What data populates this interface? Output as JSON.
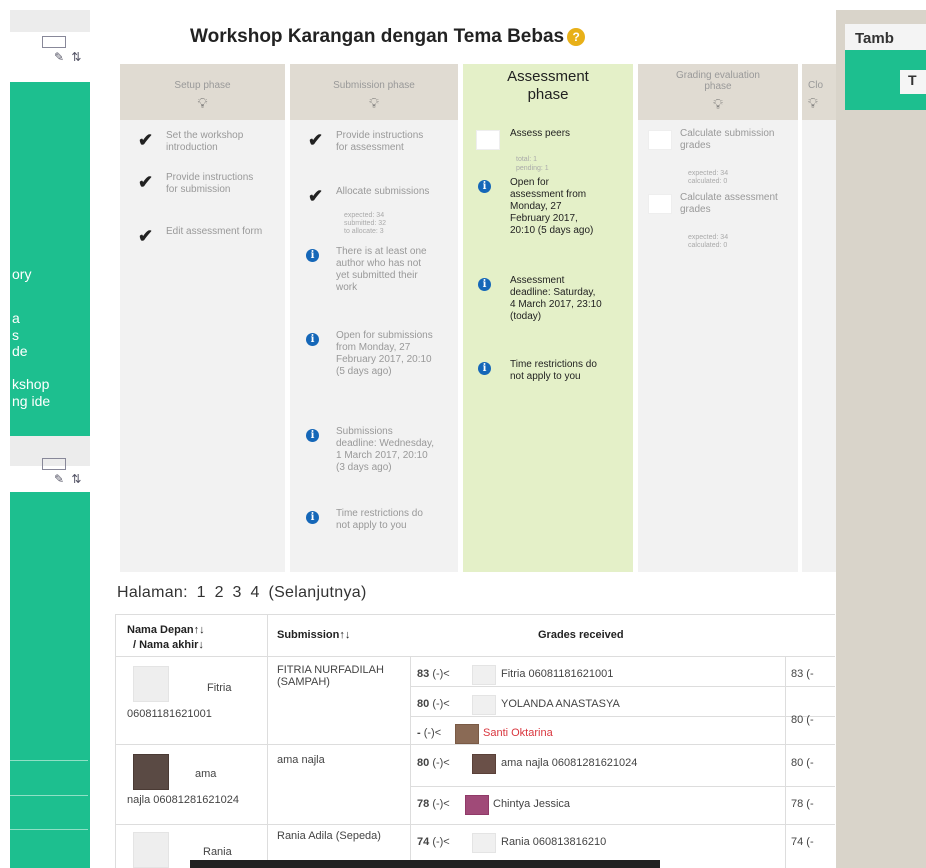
{
  "title": "Workshop Karangan dengan Tema Bebas",
  "sidebar": {
    "nav_items": [
      "ory",
      "a",
      "s",
      "de",
      "kshop",
      "ng ide"
    ]
  },
  "right_panel": {
    "heading": "Tamb",
    "button_label": "T"
  },
  "phases": [
    {
      "name": "Setup phase",
      "items": [
        {
          "icon": "check",
          "text": "Set the workshop introduction"
        },
        {
          "icon": "check",
          "text": "Provide instructions for submission"
        },
        {
          "icon": "check",
          "text": "Edit assessment form"
        }
      ]
    },
    {
      "name": "Submission phase",
      "items": [
        {
          "icon": "check",
          "text": "Provide instructions for assessment"
        },
        {
          "icon": "check",
          "text": "Allocate submissions",
          "detail": [
            "expected: 34",
            "submitted: 32",
            "to allocate: 3"
          ]
        },
        {
          "icon": "info",
          "text": "There is at least one author who has not yet submitted their work"
        },
        {
          "icon": "info",
          "text": "Open for submissions from Monday, 27 February 2017, 20:10 (5 days ago)"
        },
        {
          "icon": "info",
          "text": "Submissions deadline: Wednesday, 1 March 2017, 20:10 (3 days ago)"
        },
        {
          "icon": "info",
          "text": "Time restrictions do not apply to you"
        }
      ]
    },
    {
      "name": "Assessment phase",
      "active": true,
      "items": [
        {
          "icon": "box",
          "text": "Assess peers",
          "detail": [
            "total: 1",
            "pending: 1"
          ]
        },
        {
          "icon": "info",
          "text": "Open for assessment from Monday, 27 February 2017, 20:10 (5 days ago)"
        },
        {
          "icon": "info",
          "text": "Assessment deadline: Saturday, 4 March 2017, 23:10 (today)"
        },
        {
          "icon": "info",
          "text": "Time restrictions do not apply to you"
        }
      ]
    },
    {
      "name": "Grading evaluation phase",
      "items": [
        {
          "icon": "box",
          "text": "Calculate submission grades",
          "detail": [
            "expected: 34",
            "calculated: 0"
          ]
        },
        {
          "icon": "box",
          "text": "Calculate assessment grades",
          "detail": [
            "expected: 34",
            "calculated: 0"
          ]
        }
      ]
    },
    {
      "name": "Clo",
      "items": []
    }
  ],
  "pagination": {
    "label": "Halaman:",
    "pages": [
      "1",
      "2",
      "3",
      "4"
    ],
    "next": "(Selanjutnya)"
  },
  "grades_table": {
    "headers": {
      "name": "Nama Depan",
      "name2": "/ Nama akhir",
      "submission": "Submission",
      "received": "Grades received"
    },
    "rows": [
      {
        "first": "Fitria",
        "last": "06081181621001",
        "submission": "FITRIA NURFADILAH (SAMPAH)",
        "grades": [
          {
            "grade": "83",
            "mod": "(-)<",
            "reviewer": "Fitria 06081181621001"
          },
          {
            "grade": "80",
            "mod": "(-)<",
            "reviewer": "YOLANDA ANASTASYA"
          },
          {
            "grade": "-",
            "mod": "(-)<",
            "reviewer": "Santi Oktarina",
            "red": true
          }
        ],
        "given": [
          "83 (-",
          "80 (-"
        ]
      },
      {
        "first": "ama",
        "last": "najla 06081281621024",
        "submission": "ama najla",
        "grades": [
          {
            "grade": "80",
            "mod": "(-)<",
            "reviewer": "ama najla 06081281621024"
          },
          {
            "grade": "78",
            "mod": "(-)<",
            "reviewer": "Chintya Jessica"
          }
        ],
        "given": [
          "80 (-",
          "78 (-"
        ]
      },
      {
        "first": "Rania",
        "last": "",
        "submission": "Rania Adila (Sepeda)",
        "grades": [
          {
            "grade": "74",
            "mod": "(-)<",
            "reviewer": "Rania 060813816210"
          }
        ],
        "given": [
          "74 (-"
        ]
      }
    ]
  }
}
